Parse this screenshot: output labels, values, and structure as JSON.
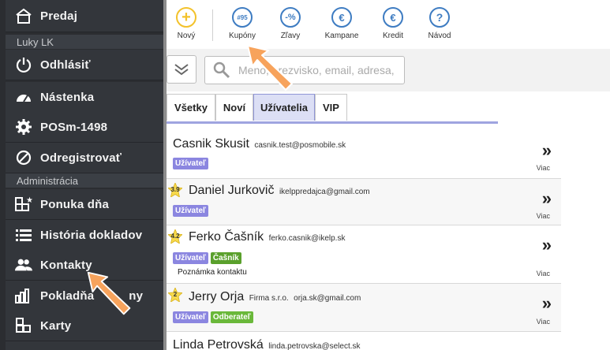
{
  "sidebar": {
    "sell_label": "Predaj",
    "user_section": "Luky LK",
    "logout_label": "Odhlásiť",
    "dashboard_label": "Nástenka",
    "device_label": "POSm-1498",
    "unregister_label": "Odregistrovať",
    "admin_section": "Administrácia",
    "daily_offer_label": "Ponuka dňa",
    "history_label": "História dokladov",
    "contacts_label": "Kontakty",
    "cashbox_label": "Pokladňa",
    "cashbox_label_tail": "ny",
    "cards_label": "Karty"
  },
  "toolbar": {
    "new_label": "Nový",
    "coupons_label": "Kupóny",
    "coupons_icon_text": "#95",
    "discounts_label": "Zľavy",
    "discounts_icon_text": "-%",
    "campaign_label": "Kampane",
    "campaign_icon_text": "€",
    "credit_label": "Kredit",
    "credit_icon_text": "€",
    "help_label": "Návod",
    "help_icon_text": "?"
  },
  "search": {
    "placeholder": "Meno, prezvisko, email, adresa, č"
  },
  "tabs": {
    "all": "Všetky",
    "new": "Noví",
    "users": "Užívatelia",
    "vip": "VIP"
  },
  "contacts": [
    {
      "name": "Casnik Skusit",
      "email": "casnik.test@posmobile.sk",
      "badges": [
        "Užívateľ"
      ],
      "more": "Viac"
    },
    {
      "name": "Daniel Jurkovič",
      "email": "ikelppredajca@gmail.com",
      "rating": "3.9",
      "badges": [
        "Užívateľ"
      ],
      "more": "Viac"
    },
    {
      "name": "Ferko Čašník",
      "email": "ferko.casnik@ikelp.sk",
      "rating": "4.2",
      "badges": [
        "Užívateľ",
        "Čašník"
      ],
      "note": "Poznámka kontaktu",
      "more": "Viac"
    },
    {
      "name": "Jerry Orja",
      "company": "Firma s.r.o.",
      "email": "orja.sk@gmail.com",
      "rating": "2",
      "badges": [
        "Užívateľ",
        "Odberateľ"
      ],
      "more": "Viac"
    },
    {
      "name": "Linda Petrovská",
      "email": "linda.petrovska@select.sk"
    }
  ],
  "more_symbol": "»",
  "colors": {
    "sidebar_bg": "#2b2d31",
    "accent_blue": "#3e7cc2",
    "new_yellow": "#f3c22b",
    "user_badge": "#8b86e0",
    "green_badge": "#5aa02c",
    "arrow_orange": "#f7a35c"
  }
}
